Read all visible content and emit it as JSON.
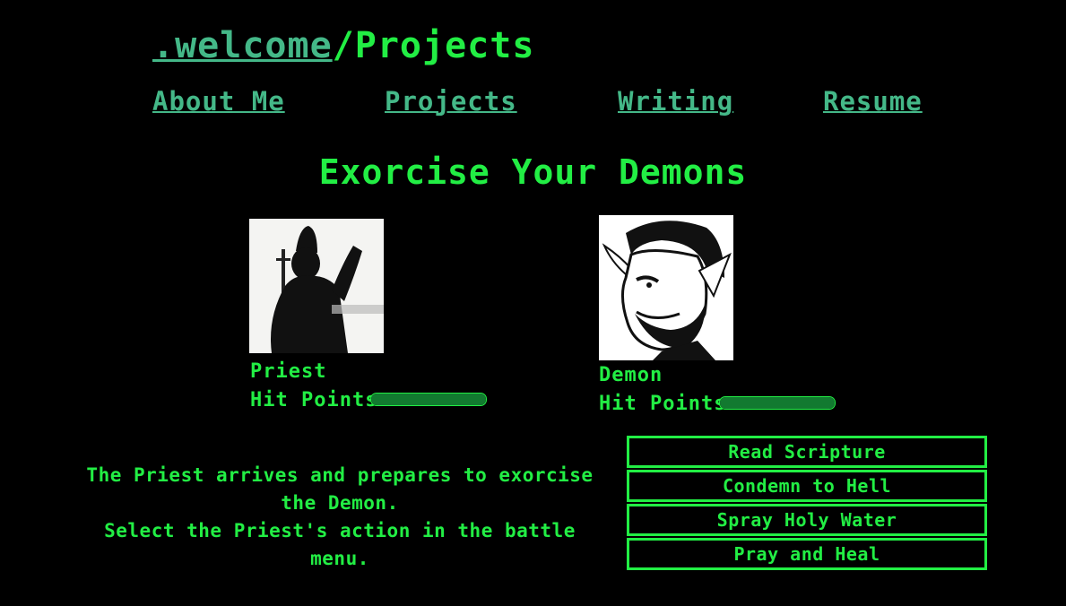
{
  "header": {
    "home_link": ".welcome",
    "separator": "/",
    "current": "Projects"
  },
  "nav": {
    "items": [
      {
        "label": "About Me"
      },
      {
        "label": "Projects"
      },
      {
        "label": "Writing"
      },
      {
        "label": "Resume"
      }
    ]
  },
  "game": {
    "title": "Exorcise Your Demons",
    "priest": {
      "name": "Priest",
      "hp_label": "Hit Points:",
      "hp_fraction": 1.0
    },
    "demon": {
      "name": "Demon",
      "hp_label": "Hit Points:",
      "hp_fraction": 1.0
    },
    "message_lines": [
      "The Priest arrives and prepares to exorcise the Demon.",
      "Select the Priest's action in the battle menu."
    ],
    "actions": [
      {
        "label": "Read Scripture"
      },
      {
        "label": "Condemn to Hell"
      },
      {
        "label": "Spray Holy Water"
      },
      {
        "label": "Pray and Heal"
      }
    ]
  },
  "colors": {
    "background": "#000000",
    "text_green": "#22ee44",
    "link_green": "#44b888",
    "hp_fill": "#127a30"
  }
}
